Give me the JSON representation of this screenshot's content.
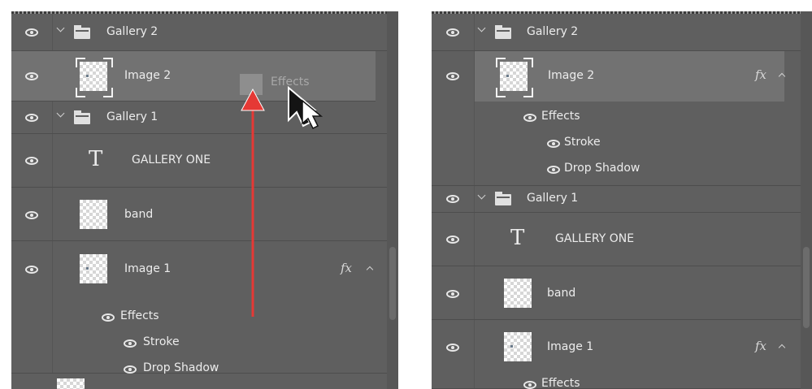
{
  "left_panel": {
    "layers": {
      "gallery2": "Gallery 2",
      "image2": "Image 2",
      "gallery1": "Gallery 1",
      "gallery_one_text": "GALLERY ONE",
      "band": "band",
      "image1": "Image 1",
      "effects": "Effects",
      "stroke": "Stroke",
      "drop_shadow": "Drop Shadow"
    },
    "image1_fx": "fx",
    "drag_ghost_label": "Effects"
  },
  "right_panel": {
    "layers": {
      "gallery2": "Gallery 2",
      "image2": "Image 2",
      "effects_image2": "Effects",
      "stroke_image2": "Stroke",
      "drop_shadow_image2": "Drop Shadow",
      "gallery1": "Gallery 1",
      "gallery_one_text": "GALLERY ONE",
      "band": "band",
      "image1": "Image 1",
      "effects_image1": "Effects"
    },
    "image2_fx": "fx",
    "image1_fx": "fx"
  },
  "annotation": {
    "arrow_color": "#e53935",
    "cursor_icon": "arrow-cursor-icon"
  },
  "colors": {
    "panel_bg": "#5f5f5f",
    "selected_row": "#727272",
    "text": "#ececec"
  }
}
